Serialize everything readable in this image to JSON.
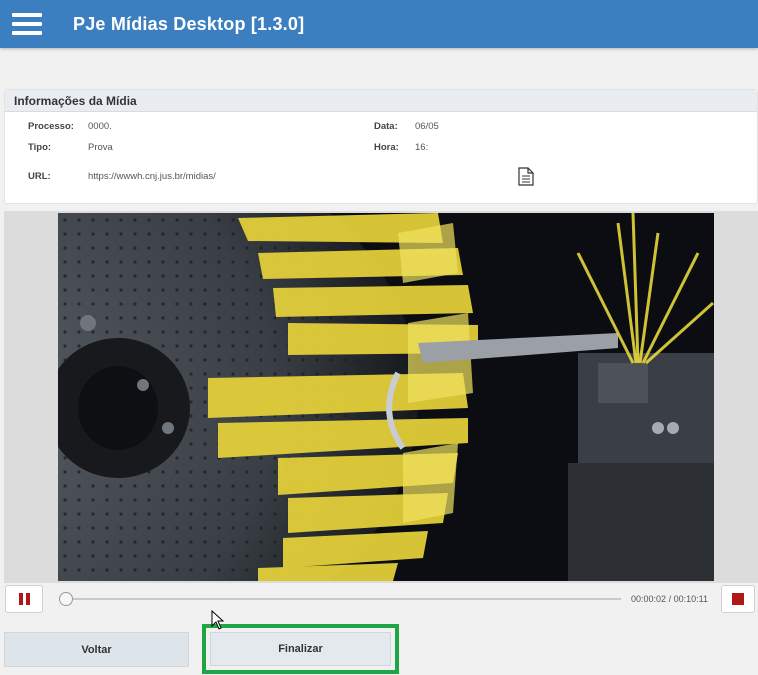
{
  "app": {
    "title": "PJe Mídias Desktop [1.3.0]",
    "menu_icon": "hamburger-menu-icon"
  },
  "info": {
    "section_title": "Informações da Mídia",
    "processo_label": "Processo:",
    "processo_value": "0000.",
    "tipo_label": "Tipo:",
    "tipo_value": "Prova",
    "url_label": "URL:",
    "url_value": "https://wwwh.cnj.jus.br/midias/",
    "data_label": "Data:",
    "data_value": "06/05",
    "hora_label": "Hora:",
    "hora_value": "16:",
    "copy_icon": "document-icon"
  },
  "player": {
    "current_time": "00:00:02",
    "total_time": "00:10:11",
    "time_separator": "/",
    "progress": 0.003,
    "pause_icon": "pause-icon",
    "stop_icon": "stop-icon"
  },
  "actions": {
    "voltar_label": "Voltar",
    "finalizar_label": "Finalizar"
  },
  "colors": {
    "header": "#3c7fc0",
    "accent_red": "#b01818",
    "highlight_green": "#1fa544"
  }
}
